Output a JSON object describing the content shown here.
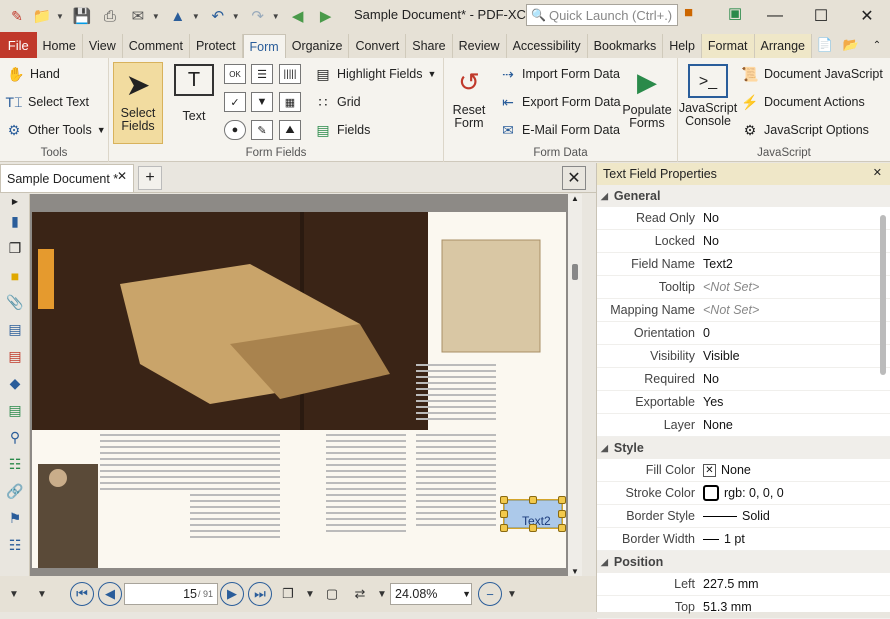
{
  "app": {
    "document_title": "Sample Document* - PDF-XCh...",
    "quick_launch_placeholder": "Quick Launch (Ctrl+.)"
  },
  "menu": {
    "file": "File",
    "tabs": [
      "Home",
      "View",
      "Comment",
      "Protect",
      "Form",
      "Organize",
      "Convert",
      "Share",
      "Review",
      "Accessibility",
      "Bookmarks",
      "Help",
      "Format",
      "Arrange"
    ],
    "active_tab": "Form"
  },
  "ribbon": {
    "tools": {
      "label": "Tools",
      "hand": "Hand",
      "select_text": "Select Text",
      "other_tools": "Other Tools"
    },
    "form_fields": {
      "label": "Form Fields",
      "select_fields": "Select Fields",
      "text": "Text",
      "highlight_fields": "Highlight Fields",
      "grid": "Grid",
      "fields": "Fields"
    },
    "form_data": {
      "label": "Form Data",
      "reset_form": "Reset Form",
      "import": "Import Form Data",
      "export": "Export Form Data",
      "email": "E-Mail Form Data",
      "populate": "Populate Forms"
    },
    "javascript": {
      "label": "JavaScript",
      "console": "JavaScript Console",
      "doc_js": "Document JavaScript",
      "doc_actions": "Document Actions",
      "js_options": "JavaScript Options"
    }
  },
  "document": {
    "tab_name": "Sample Document *",
    "page_current": "15",
    "page_total": "/ 91",
    "zoom": "24.08%",
    "selected_field_text": "Text2"
  },
  "properties": {
    "title": "Text Field Properties",
    "general_label": "General",
    "general": [
      {
        "k": "Read Only",
        "v": "No"
      },
      {
        "k": "Locked",
        "v": "No"
      },
      {
        "k": "Field Name",
        "v": "Text2"
      },
      {
        "k": "Tooltip",
        "v": "<Not Set>"
      },
      {
        "k": "Mapping Name",
        "v": "<Not Set>"
      },
      {
        "k": "Orientation",
        "v": "0"
      },
      {
        "k": "Visibility",
        "v": "Visible"
      },
      {
        "k": "Required",
        "v": "No"
      },
      {
        "k": "Exportable",
        "v": "Yes"
      },
      {
        "k": "Layer",
        "v": "None"
      }
    ],
    "style_label": "Style",
    "style": {
      "fill_k": "Fill Color",
      "fill_v": "None",
      "stroke_k": "Stroke Color",
      "stroke_v": "rgb: 0, 0, 0",
      "bstyle_k": "Border Style",
      "bstyle_v": "Solid",
      "bwidth_k": "Border Width",
      "bwidth_v": "1 pt"
    },
    "position_label": "Position",
    "position": [
      {
        "k": "Left",
        "v": "227.5 mm"
      },
      {
        "k": "Top",
        "v": "51.3 mm"
      }
    ]
  },
  "colors": {
    "accent": "#2a5d9a",
    "file_tab": "#c0392b",
    "panel_header": "#efe7c8",
    "selection": "#f2dca0"
  }
}
